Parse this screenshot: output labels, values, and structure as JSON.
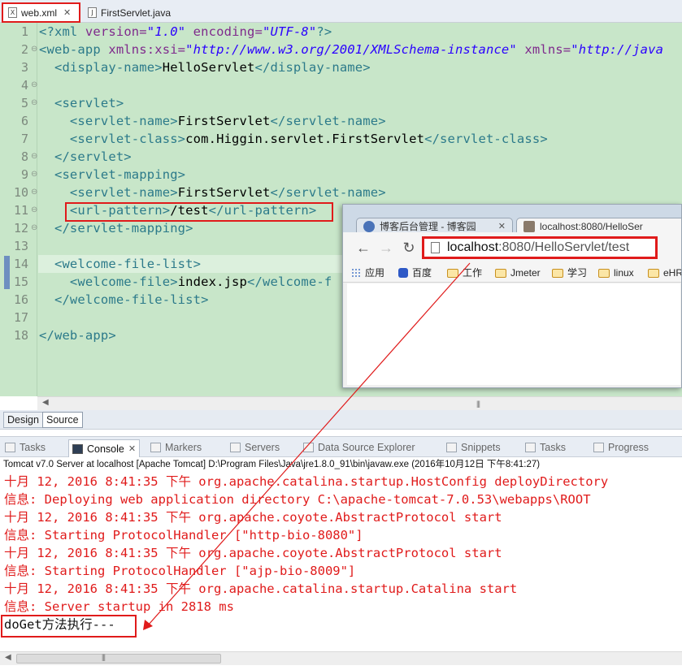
{
  "editor_tabs": [
    {
      "label": "web.xml",
      "active": true
    },
    {
      "label": "FirstServlet.java",
      "active": false
    }
  ],
  "code": {
    "line_numbers": [
      "1",
      "2",
      "3",
      "4",
      "5",
      "6",
      "7",
      "8",
      "9",
      "10",
      "11",
      "12",
      "13",
      "14",
      "15",
      "16",
      "17",
      "18"
    ],
    "lines": {
      "l1_open": "<?xml ",
      "l1_attr1": "version=",
      "l1_val1": "\"1.0\"",
      "l1_attr2": " encoding=",
      "l1_val2": "\"UTF-8\"",
      "l1_close": "?>",
      "l2_tag": "<web-app ",
      "l2_attr1": "xmlns:xsi=",
      "l2_val1": "\"http://www.w3.org/2001/XMLSchema-instance\"",
      "l2_attr2": " xmlns=",
      "l2_val2": "\"http://java",
      "l3_open": "  <display-name>",
      "l3_text": "HelloServlet",
      "l3_close": "</display-name>",
      "l5": "  <servlet>",
      "l6_open": "    <servlet-name>",
      "l6_text": "FirstServlet",
      "l6_close": "</servlet-name>",
      "l7_open": "    <servlet-class>",
      "l7_text": "com.Higgin.servlet.FirstServlet",
      "l7_close": "</servlet-class>",
      "l8": "  </servlet>",
      "l9": "  <servlet-mapping>",
      "l10_open": "    <servlet-name>",
      "l10_text": "FirstServlet",
      "l10_close": "</servlet-name>",
      "l11_open": "    <url-pattern>",
      "l11_text": "/test",
      "l11_close": "</url-pattern>",
      "l12": "  </servlet-mapping>",
      "l14": "  <welcome-file-list>",
      "l15_open": "    <welcome-file>",
      "l15_text": "index.jsp",
      "l15_close": "</welcome-f",
      "l16": "  </welcome-file-list>",
      "l18": "</web-app>"
    }
  },
  "browser": {
    "tabs": [
      {
        "label": "博客后台管理 - 博客园"
      },
      {
        "label": "localhost:8080/HelloSer"
      }
    ],
    "url_host": "localhost",
    "url_path": ":8080/HelloServlet/test",
    "bookmarks": [
      "应用",
      "百度",
      "工作",
      "Jmeter",
      "学习",
      "linux",
      "eHR"
    ]
  },
  "editor_bottom_tabs": [
    "Design",
    "Source"
  ],
  "view_tabs": [
    "Tasks",
    "Console",
    "Markers",
    "Servers",
    "Data Source Explorer",
    "Snippets",
    "Tasks",
    "Progress"
  ],
  "console": {
    "title": "Tomcat v7.0 Server at localhost [Apache Tomcat] D:\\Program Files\\Java\\jre1.8.0_91\\bin\\javaw.exe (2016年10月12日 下午8:41:27)",
    "lines": [
      "十月 12, 2016 8:41:35 下午 org.apache.catalina.startup.HostConfig deployDirectory",
      "信息: Deploying web application directory C:\\apache-tomcat-7.0.53\\webapps\\ROOT",
      "十月 12, 2016 8:41:35 下午 org.apache.coyote.AbstractProtocol start",
      "信息: Starting ProtocolHandler [\"http-bio-8080\"]",
      "十月 12, 2016 8:41:35 下午 org.apache.coyote.AbstractProtocol start",
      "信息: Starting ProtocolHandler [\"ajp-bio-8009\"]",
      "十月 12, 2016 8:41:35 下午 org.apache.catalina.startup.Catalina start",
      "信息: Server startup in 2818 ms"
    ],
    "output": "doGet方法执行---"
  },
  "colors": {
    "editor_bg": "#c8e6c9",
    "highlight": "#e01b1b",
    "xml_tag": "#2c7a8a",
    "xml_attr": "#7f2a8c",
    "xml_string": "#2a00ff",
    "console_stderr": "#e01b1b"
  }
}
